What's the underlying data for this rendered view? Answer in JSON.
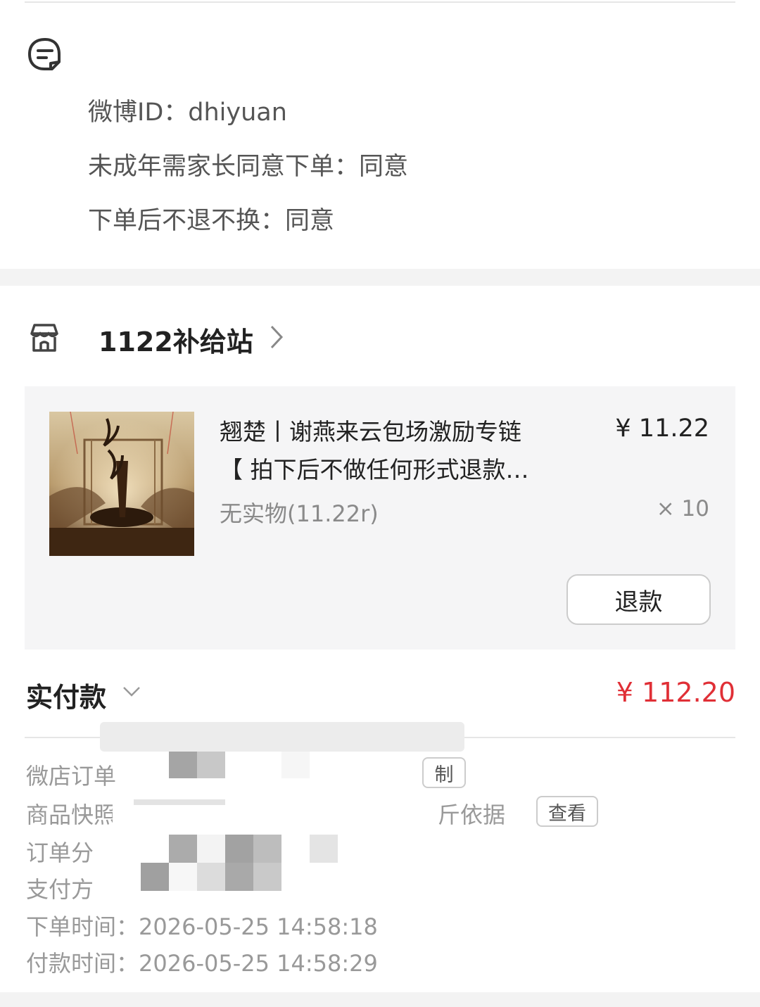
{
  "remarks": {
    "lines": [
      "微博ID：dhiyuan",
      "未成年需家长同意下单：同意",
      "下单后不退不换：同意"
    ]
  },
  "shop": {
    "name": "1122补给站"
  },
  "product": {
    "title_line1": "翘楚丨谢燕来云包场激励专链",
    "title_line2": "【 拍下后不做任何形式退款…",
    "spec": "无实物(11.22r)",
    "price": "¥ 11.22",
    "quantity": "× 10",
    "refund_label": "退款"
  },
  "payment": {
    "paid_label": "实付款",
    "paid_amount": "¥ 112.20"
  },
  "order_info": {
    "order_no_label": "微店订单",
    "order_no_btn_fragment": "制",
    "snapshot_label": "商品快照",
    "snapshot_fragment": "斤依据",
    "snapshot_btn": "查看",
    "split_label": "订单分",
    "pay_method_label": "支付方",
    "order_time_label": "下单时间：",
    "order_time": "2026-05-25 14:58:18",
    "pay_time_label": "付款时间：",
    "pay_time": "2026-05-25 14:58:29"
  },
  "colors": {
    "accent_red": "#e02f36",
    "card_bg": "#f5f5f6",
    "band_bg": "#f3f3f3"
  },
  "icons": {
    "remark": "message-note-icon",
    "shop": "storefront-icon",
    "shop_chevron": "chevron-right-icon",
    "paid_chevron": "chevron-down-icon"
  }
}
